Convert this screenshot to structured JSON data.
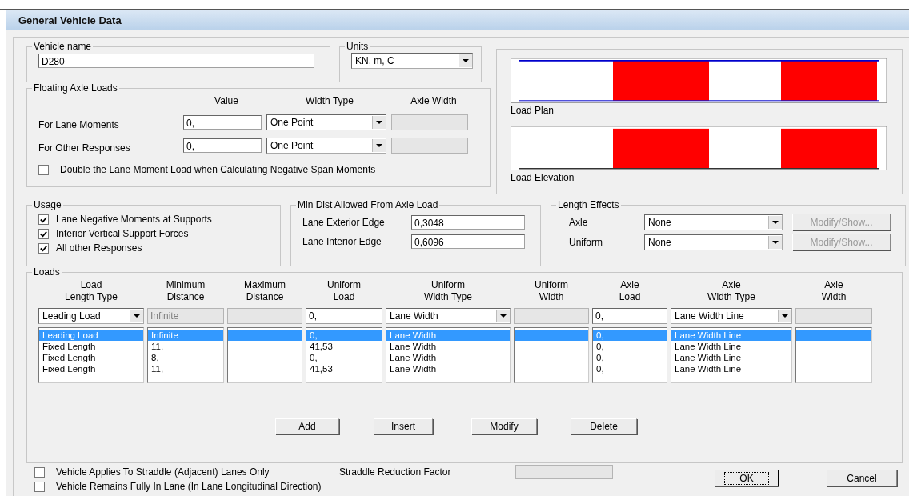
{
  "window": {
    "title": "General Vehicle Data"
  },
  "vehicle_name": {
    "label": "Vehicle name",
    "value": "D280"
  },
  "units": {
    "label": "Units",
    "value": "KN, m, C"
  },
  "floating_axle_loads": {
    "title": "Floating Axle Loads",
    "columns": [
      "Value",
      "Width Type",
      "Axle Width"
    ],
    "rows": [
      {
        "label": "For Lane Moments",
        "value": "0,",
        "width_type": "One Point"
      },
      {
        "label": "For Other Responses",
        "value": "0,",
        "width_type": "One Point"
      }
    ],
    "double_option": {
      "label": "Double the Lane Moment Load when Calculating Negative Span Moments",
      "checked": false
    }
  },
  "preview": {
    "plan_label": "Load Plan",
    "elevation_label": "Load Elevation"
  },
  "usage": {
    "title": "Usage",
    "options": [
      {
        "label": "Lane Negative Moments at Supports",
        "checked": true
      },
      {
        "label": "Interior Vertical Support Forces",
        "checked": true
      },
      {
        "label": "All other Responses",
        "checked": true
      }
    ]
  },
  "min_dist": {
    "title": "Min Dist Allowed From Axle Load",
    "fields": [
      {
        "label": "Lane Exterior Edge",
        "value": "0,3048"
      },
      {
        "label": "Lane Interior Edge",
        "value": "0,6096"
      }
    ]
  },
  "length_effects": {
    "title": "Length Effects",
    "rows": [
      {
        "label": "Axle",
        "value": "None",
        "button": "Modify/Show...",
        "disabled": true
      },
      {
        "label": "Uniform",
        "value": "None",
        "button": "Modify/Show...",
        "disabled": true
      }
    ]
  },
  "loads": {
    "title": "Loads",
    "columns": [
      {
        "heading": [
          "Load",
          "Length Type"
        ],
        "kind": "combo",
        "input": "Leading Load"
      },
      {
        "heading": [
          "Minimum",
          "Distance"
        ],
        "kind": "text",
        "input": "Infinite",
        "disabled": true
      },
      {
        "heading": [
          "Maximum",
          "Distance"
        ],
        "kind": "text",
        "disabled": true
      },
      {
        "heading": [
          "Uniform",
          "Load"
        ],
        "kind": "text",
        "input": "0,",
        "disabled": false
      },
      {
        "heading": [
          "Uniform",
          "Width Type"
        ],
        "kind": "combo",
        "input": "Lane Width"
      },
      {
        "heading": [
          "Uniform",
          "Width"
        ],
        "kind": "text",
        "disabled": true
      },
      {
        "heading": [
          "Axle",
          "Load"
        ],
        "kind": "text",
        "input": "0,",
        "disabled": false
      },
      {
        "heading": [
          "Axle",
          "Width Type"
        ],
        "kind": "combo",
        "input": "Lane Width Line"
      },
      {
        "heading": [
          "Axle",
          "Width"
        ],
        "kind": "text",
        "disabled": true
      }
    ],
    "rows": [
      {
        "selected": true,
        "cells": [
          "Leading Load",
          "Infinite",
          null,
          "0,",
          "Lane Width",
          null,
          "0,",
          "Lane Width Line",
          null
        ]
      },
      {
        "selected": false,
        "cells": [
          "Fixed Length",
          "11,",
          null,
          "41,53",
          "Lane Width",
          null,
          "0,",
          "Lane Width Line",
          null
        ]
      },
      {
        "selected": false,
        "cells": [
          "Fixed Length",
          "8,",
          null,
          "0,",
          "Lane Width",
          null,
          "0,",
          "Lane Width Line",
          null
        ]
      },
      {
        "selected": false,
        "cells": [
          "Fixed Length",
          "11,",
          null,
          "41,53",
          "Lane Width",
          null,
          "0,",
          "Lane Width Line",
          null
        ]
      }
    ],
    "buttons": [
      "Add",
      "Insert",
      "Modify",
      "Delete"
    ]
  },
  "straddle": {
    "label": "Vehicle Applies To Straddle (Adjacent) Lanes Only",
    "checked": false,
    "factor_label": "Straddle Reduction Factor"
  },
  "remains_in_lane": {
    "label": "Vehicle Remains Fully In Lane (In Lane Longitudinal Direction)",
    "checked": false
  },
  "dialog_buttons": [
    {
      "label": "OK",
      "focused": true
    },
    {
      "label": "Cancel",
      "focused": false
    }
  ]
}
